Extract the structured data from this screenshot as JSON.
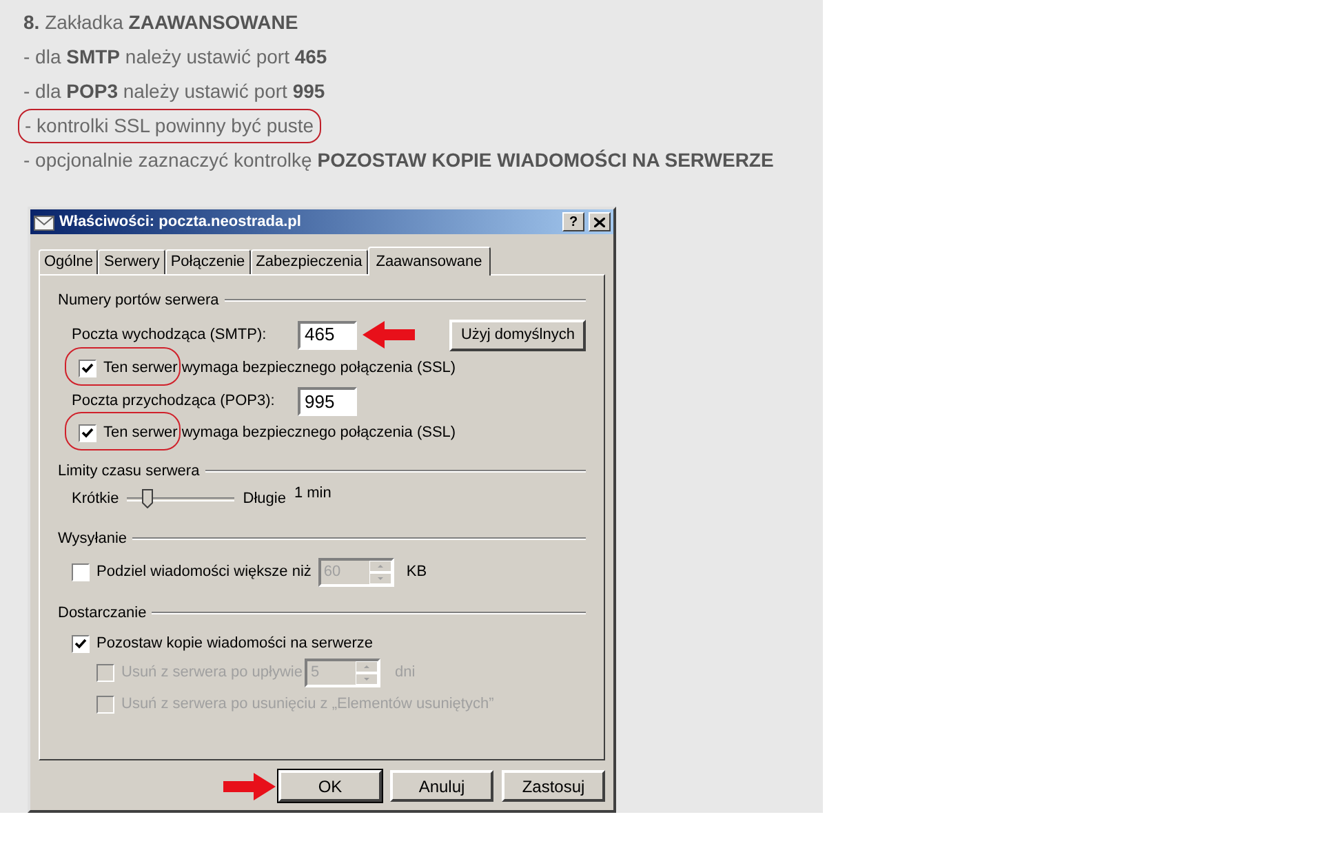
{
  "instructions": [
    {
      "text": "**8.** Zakładka **ZAAWANSOWANE**",
      "highlighted": false
    },
    {
      "text": "- dla **SMTP** należy ustawić port **465**",
      "highlighted": false
    },
    {
      "text": "- dla **POP3** należy ustawić port **995**",
      "highlighted": false
    },
    {
      "text": "- kontrolki SSL powinny być puste",
      "highlighted": true
    },
    {
      "text": "- opcjonalnie zaznaczyć kontrolkę **POZOSTAW KOPIE WIADOMOŚCI NA SERWERZE**",
      "highlighted": false
    }
  ],
  "dialog": {
    "title": "Właściwości: poczta.neostrada.pl",
    "help_button": "?",
    "tabs": [
      {
        "label": "Ogólne",
        "selected": false
      },
      {
        "label": "Serwery",
        "selected": false
      },
      {
        "label": "Połączenie",
        "selected": false
      },
      {
        "label": "Zabezpieczenia",
        "selected": false
      },
      {
        "label": "Zaawansowane",
        "selected": true
      }
    ],
    "ports": {
      "heading": "Numery portów serwera",
      "smtp": {
        "label": "Poczta wychodząca (SMTP):",
        "value": "465",
        "arrow": true
      },
      "defaults_button": "Użyj domyślnych",
      "smtp_ssl": {
        "label": "Ten serwer wymaga bezpiecznego połączenia (SSL)",
        "checked": true,
        "highlighted": true
      },
      "pop3": {
        "label": "Poczta przychodząca (POP3):",
        "value": "995",
        "arrow": false
      },
      "pop3_ssl": {
        "label": "Ten serwer wymaga bezpiecznego połączenia (SSL)",
        "checked": true,
        "highlighted": true
      }
    },
    "timeout": {
      "heading": "Limity czasu serwera",
      "min_label": "Krótkie",
      "max_label": "Długie",
      "level": 0.15,
      "reading": "1 min"
    },
    "sending": {
      "heading": "Wysyłanie",
      "split": {
        "label": "Podziel wiadomości większe niż",
        "checked": false,
        "value": "60",
        "value_disabled": true,
        "unit": "KB"
      }
    },
    "delivery": {
      "heading": "Dostarczanie",
      "keep_copy": {
        "label": "Pozostaw kopie wiadomości na serwerze",
        "checked": true,
        "disabled": false
      },
      "remove_after": {
        "label": "Usuń z serwera po upływie",
        "checked": false,
        "disabled": true,
        "value": "5",
        "unit": "dni"
      },
      "remove_deleted": {
        "label": "Usuń z serwera po usunięciu z „Elementów usuniętych”",
        "checked": false,
        "disabled": true
      }
    },
    "buttons": [
      {
        "label": "OK",
        "default": true,
        "arrow": true
      },
      {
        "label": "Anuluj",
        "default": false,
        "arrow": false
      },
      {
        "label": "Zastosuj",
        "default": false,
        "arrow": false
      }
    ]
  }
}
